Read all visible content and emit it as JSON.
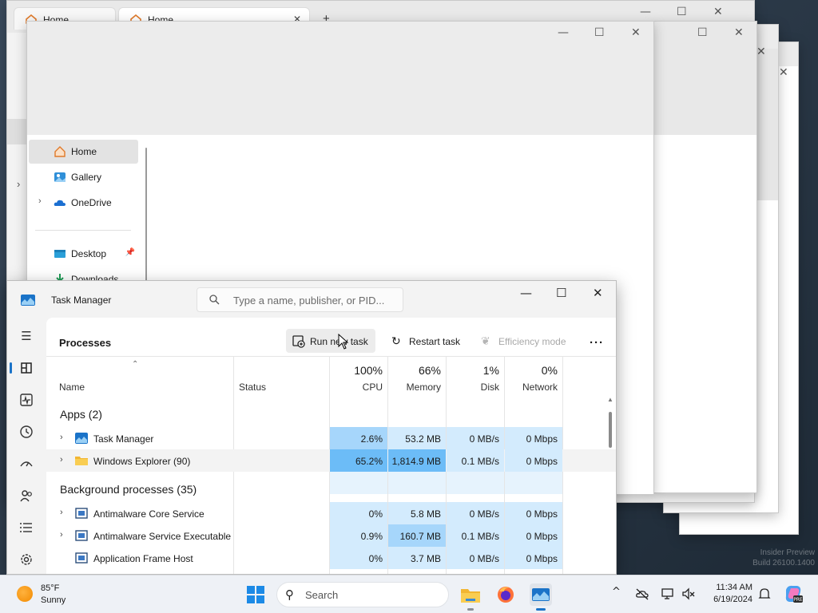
{
  "explorer_back": {
    "tabs": [
      {
        "label": "Home"
      },
      {
        "label": "Home"
      }
    ],
    "new_tab": "+",
    "chevron": "›"
  },
  "explorer_front": {
    "nav": [
      {
        "label": "Home",
        "icon": "home-icon"
      },
      {
        "label": "Gallery",
        "icon": "gallery-icon"
      },
      {
        "label": "OneDrive",
        "icon": "cloud-icon"
      },
      {
        "label": "Desktop",
        "icon": "desktop-folder-icon"
      },
      {
        "label": "Downloads",
        "icon": "downloads-icon"
      }
    ]
  },
  "window_controls": {
    "minimize": "—",
    "maximize": "☐",
    "close": "✕"
  },
  "watermark": {
    "line1": "Insider Preview",
    "line2": "Build 26100.1400"
  },
  "task_manager": {
    "title": "Task Manager",
    "search_placeholder": "Type a name, publisher, or PID...",
    "page_title": "Processes",
    "toolbar": {
      "run_new_task": "Run new task",
      "restart_task": "Restart task",
      "efficiency_mode": "Efficiency mode",
      "more": "···"
    },
    "columns": {
      "name": "Name",
      "status": "Status",
      "cpu_pct": "100%",
      "cpu": "CPU",
      "memory_pct": "66%",
      "memory": "Memory",
      "disk_pct": "1%",
      "disk": "Disk",
      "network_pct": "0%",
      "network": "Network"
    },
    "groups": {
      "apps": "Apps (2)",
      "background": "Background processes (35)"
    },
    "apps": [
      {
        "name": "Task Manager",
        "cpu": "2.6%",
        "memory": "53.2 MB",
        "disk": "0 MB/s",
        "network": "0 Mbps"
      },
      {
        "name": "Windows Explorer (90)",
        "cpu": "65.2%",
        "memory": "1,814.9 MB",
        "disk": "0.1 MB/s",
        "network": "0 Mbps"
      }
    ],
    "background": [
      {
        "name": "Antimalware Core Service",
        "cpu": "0%",
        "memory": "5.8 MB",
        "disk": "0 MB/s",
        "network": "0 Mbps"
      },
      {
        "name": "Antimalware Service Executable",
        "cpu": "0.9%",
        "memory": "160.7 MB",
        "disk": "0.1 MB/s",
        "network": "0 Mbps"
      },
      {
        "name": "Application Frame Host",
        "cpu": "0%",
        "memory": "3.7 MB",
        "disk": "0 MB/s",
        "network": "0 Mbps"
      }
    ],
    "sidebar_icons": [
      "hamburger-icon",
      "processes-icon",
      "performance-icon",
      "app-history-icon",
      "startup-apps-icon",
      "users-icon",
      "details-icon",
      "services-icon"
    ]
  },
  "taskbar": {
    "weather_temp": "85°F",
    "weather_desc": "Sunny",
    "search_label": "Search",
    "clock_time": "11:34 AM",
    "clock_date": "6/19/2024",
    "tray_chevron": "^"
  },
  "colors": {
    "heat_low": "#d3ebfd",
    "heat_mid": "#a6d6fb",
    "heat_high": "#6cbcf7",
    "accent": "#1a73c8"
  }
}
